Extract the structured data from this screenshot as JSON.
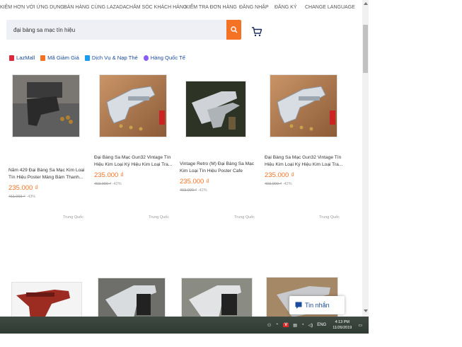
{
  "toplinks": [
    "KIỆM HƠN VỚI ỨNG DỤNG",
    "BÁN HÀNG CÙNG LAZADA",
    "CHĂM SÓC KHÁCH HÀNG",
    "KIỂM TRA ĐƠN HÀNG",
    "ĐĂNG NHẬP",
    "ĐĂNG KÝ",
    "CHANGE LANGUAGE"
  ],
  "search": {
    "value": "đại bàng sa mạc tín hiệu"
  },
  "categories": [
    {
      "label": "LazMall",
      "icon": "lazmall-icon",
      "color": "#e0283a"
    },
    {
      "label": "Mã Giảm Giá",
      "icon": "voucher-icon",
      "color": "#f57224"
    },
    {
      "label": "Dịch Vụ & Nạp Thẻ",
      "icon": "topup-icon",
      "color": "#1a9cf0"
    },
    {
      "label": "Hàng Quốc Tế",
      "icon": "global-icon",
      "color": "#8b5cf6"
    }
  ],
  "products": [
    {
      "title": "Năm 429 Đại Bàng Sa Mạc Kim Loại Tín Hiệu Poster Màng Bám Thanh...",
      "price": "235.000 ₫",
      "old": "411.069 ₫",
      "discount": "-43%",
      "origin": "Trung Quốc"
    },
    {
      "title": "Đại Bàng Sa Mạc Gun32 Vintage Tín Hiệu Kim Loại Ký Hiệu Kim Loại Tra...",
      "price": "235.000 ₫",
      "old": "403.000 ₫",
      "discount": "-42%",
      "origin": "Trung Quốc"
    },
    {
      "title": "Vintage Retro (M) Đại Bàng Sa Mạc Kim Loại Tín Hiệu Poster Cafe Nghệ...",
      "price": "235.000 ₫",
      "old": "403.000 ₫",
      "discount": "-42%",
      "origin": "Trung Quốc"
    },
    {
      "title": "Đại Bàng Sa Mạc Gun32 Vintage Tín Hiệu Kim Loại Ký Hiệu Kim Loại Tra...",
      "price": "235.000 ₫",
      "old": "403.000 ₫",
      "discount": "-42%",
      "origin": "Trung Quốc"
    }
  ],
  "chat": {
    "label": "Tin nhắn"
  },
  "taskbar": {
    "lang": "ENG",
    "time": "4:13 PM",
    "date": "11/26/2019"
  }
}
